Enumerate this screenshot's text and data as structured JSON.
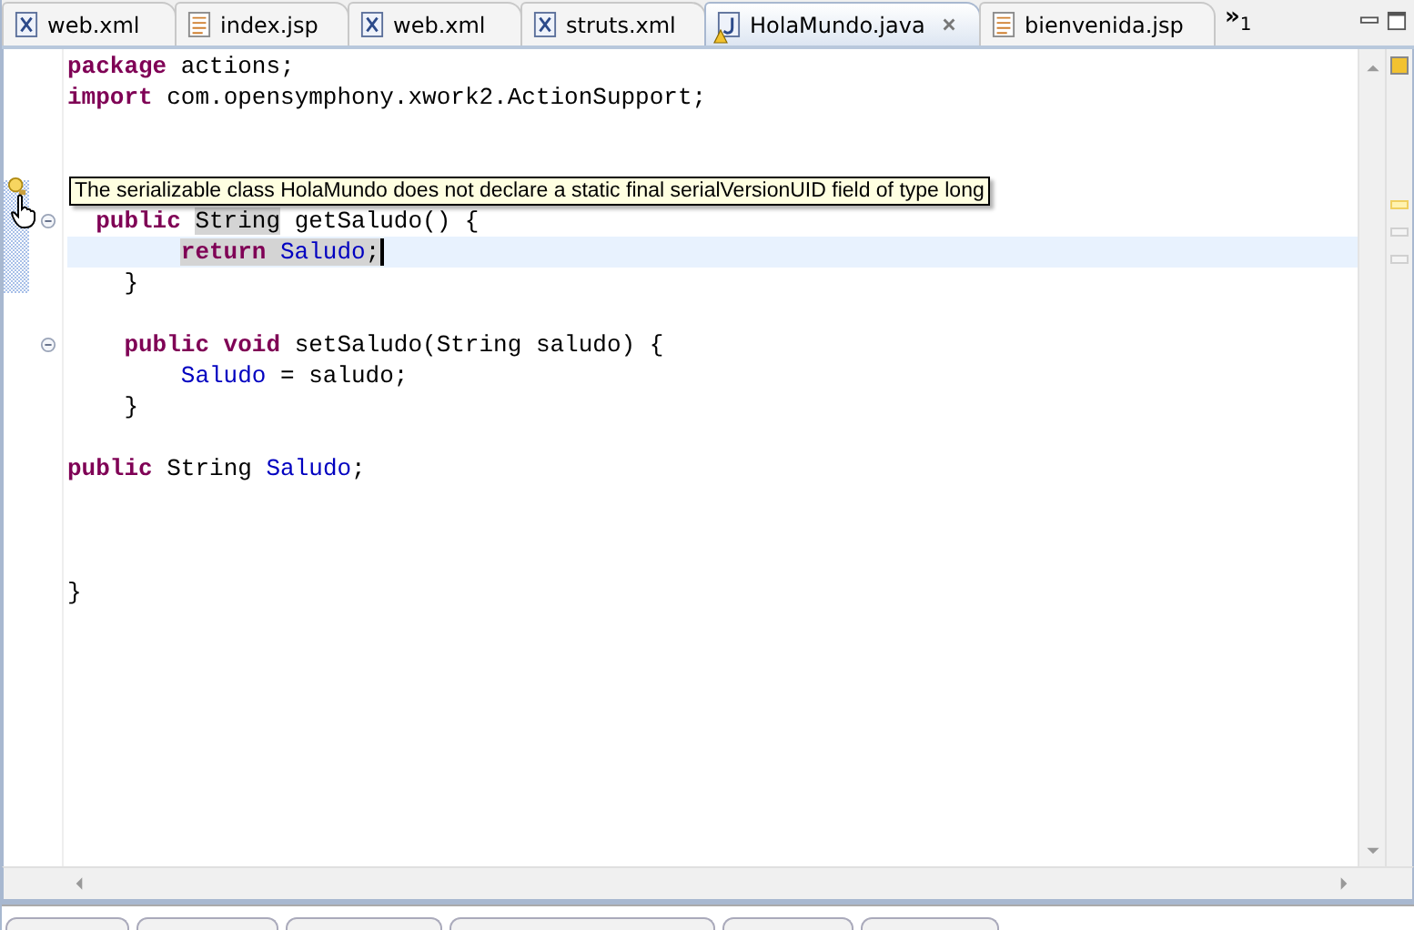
{
  "tabs": [
    {
      "label": "web.xml",
      "kind": "xml",
      "selected": false,
      "warning": false
    },
    {
      "label": "index.jsp",
      "kind": "jsp",
      "selected": false,
      "warning": false
    },
    {
      "label": "web.xml",
      "kind": "xml",
      "selected": false,
      "warning": false
    },
    {
      "label": "struts.xml",
      "kind": "xml",
      "selected": false,
      "warning": false
    },
    {
      "label": "HolaMundo.java",
      "kind": "java",
      "selected": true,
      "warning": true
    },
    {
      "label": "bienvenida.jsp",
      "kind": "jsp",
      "selected": false,
      "warning": false
    }
  ],
  "overflow": {
    "chevron": "»",
    "count": "1"
  },
  "editor": {
    "lines": [
      {
        "current": false,
        "fold": false,
        "cursor": false,
        "tokens": [
          {
            "kind": "keyword",
            "text": "package",
            "marked": false
          },
          {
            "kind": "plain",
            "text": " actions;",
            "marked": false
          }
        ]
      },
      {
        "current": false,
        "fold": false,
        "cursor": false,
        "tokens": [
          {
            "kind": "keyword",
            "text": "import",
            "marked": false
          },
          {
            "kind": "plain",
            "text": " com.opensymphony.xwork2.ActionSupport;",
            "marked": false
          }
        ]
      },
      {
        "current": false,
        "fold": false,
        "cursor": false
      },
      {
        "current": false,
        "fold": false,
        "cursor": false
      },
      {
        "current": false,
        "fold": false,
        "cursor": false
      },
      {
        "current": false,
        "fold": true,
        "cursor": false,
        "tokens": [
          {
            "kind": "keyword",
            "text": "  public ",
            "marked": false
          },
          {
            "kind": "plain",
            "text": "String",
            "marked": true
          },
          {
            "kind": "plain",
            "text": " getSaludo() {",
            "marked": false
          }
        ]
      },
      {
        "current": true,
        "fold": false,
        "cursor": true,
        "tokens": [
          {
            "kind": "keyword",
            "text": "        return ",
            "marked": true
          },
          {
            "kind": "field",
            "text": "Saludo",
            "marked": true
          },
          {
            "kind": "plain",
            "text": ";",
            "marked": true
          }
        ]
      },
      {
        "current": false,
        "fold": false,
        "cursor": false,
        "tokens": [
          {
            "kind": "plain",
            "text": "    }",
            "marked": false
          }
        ]
      },
      {
        "current": false,
        "fold": false,
        "cursor": false
      },
      {
        "current": false,
        "fold": true,
        "cursor": false,
        "tokens": [
          {
            "kind": "keyword",
            "text": "    public void",
            "marked": false
          },
          {
            "kind": "plain",
            "text": " setSaludo(String saludo) {",
            "marked": false
          }
        ]
      },
      {
        "current": false,
        "fold": false,
        "cursor": false,
        "tokens": [
          {
            "kind": "field",
            "text": "        Saludo",
            "marked": false
          },
          {
            "kind": "plain",
            "text": " = saludo;",
            "marked": false
          }
        ]
      },
      {
        "current": false,
        "fold": false,
        "cursor": false,
        "tokens": [
          {
            "kind": "plain",
            "text": "    }",
            "marked": false
          }
        ]
      },
      {
        "current": false,
        "fold": false,
        "cursor": false
      },
      {
        "current": false,
        "fold": false,
        "cursor": false,
        "tokens": [
          {
            "kind": "keyword",
            "text": "public",
            "marked": false
          },
          {
            "kind": "plain",
            "text": " String ",
            "marked": false
          },
          {
            "kind": "field",
            "text": "Saludo",
            "marked": false
          },
          {
            "kind": "plain",
            "text": ";",
            "marked": false
          }
        ]
      },
      {
        "current": false,
        "fold": false,
        "cursor": false
      },
      {
        "current": false,
        "fold": false,
        "cursor": false
      },
      {
        "current": false,
        "fold": false,
        "cursor": false
      },
      {
        "current": false,
        "fold": false,
        "cursor": false,
        "tokens": [
          {
            "kind": "plain",
            "text": "}",
            "marked": false
          }
        ]
      }
    ],
    "tooltip": "The serializable class HolaMundo does not declare a static final serialVersionUID field of type long"
  }
}
